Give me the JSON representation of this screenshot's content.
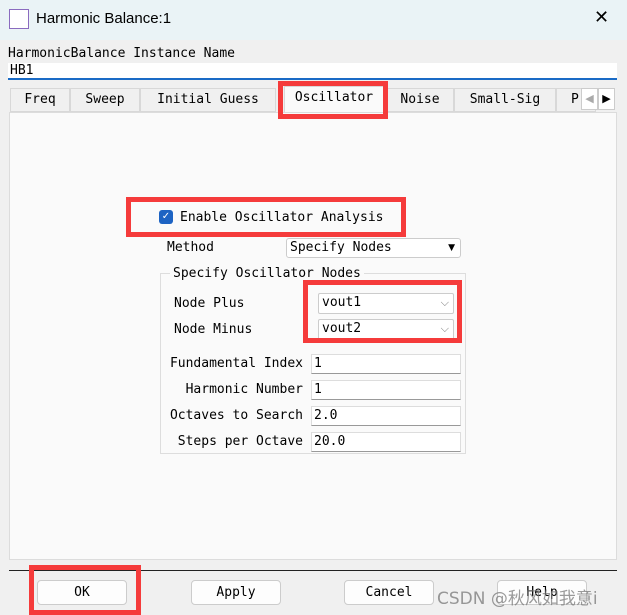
{
  "window": {
    "title": "Harmonic Balance:1",
    "close_icon": "close-icon",
    "app_icon": "harmonic-balance-icon"
  },
  "instance": {
    "label": "HarmonicBalance Instance Name",
    "value": "HB1"
  },
  "tabs": [
    {
      "label": "Freq"
    },
    {
      "label": "Sweep"
    },
    {
      "label": "Initial Guess"
    },
    {
      "label": "Oscillator",
      "selected": true
    },
    {
      "label": "Noise"
    },
    {
      "label": "Small-Sig"
    },
    {
      "label": "P"
    }
  ],
  "oscillator": {
    "enable_label": "Enable Oscillator Analysis",
    "enable_checked": true,
    "method_label": "Method",
    "method_value": "Specify Nodes",
    "group_title": "Specify Oscillator Nodes",
    "node_plus_label": "Node Plus",
    "node_plus_value": "vout1",
    "node_minus_label": "Node Minus",
    "node_minus_value": "vout2",
    "fields": [
      {
        "label": "Fundamental Index",
        "value": "1"
      },
      {
        "label": "Harmonic Number",
        "value": "1"
      },
      {
        "label": "Octaves to Search",
        "value": "2.0"
      },
      {
        "label": "Steps per Octave",
        "value": "20.0"
      }
    ]
  },
  "buttons": {
    "ok": "OK",
    "apply": "Apply",
    "cancel": "Cancel",
    "help": "Help"
  },
  "watermark": "CSDN @秋风如我意i",
  "colors": {
    "highlight": "#f53b3b",
    "accent": "#1d63c3"
  }
}
